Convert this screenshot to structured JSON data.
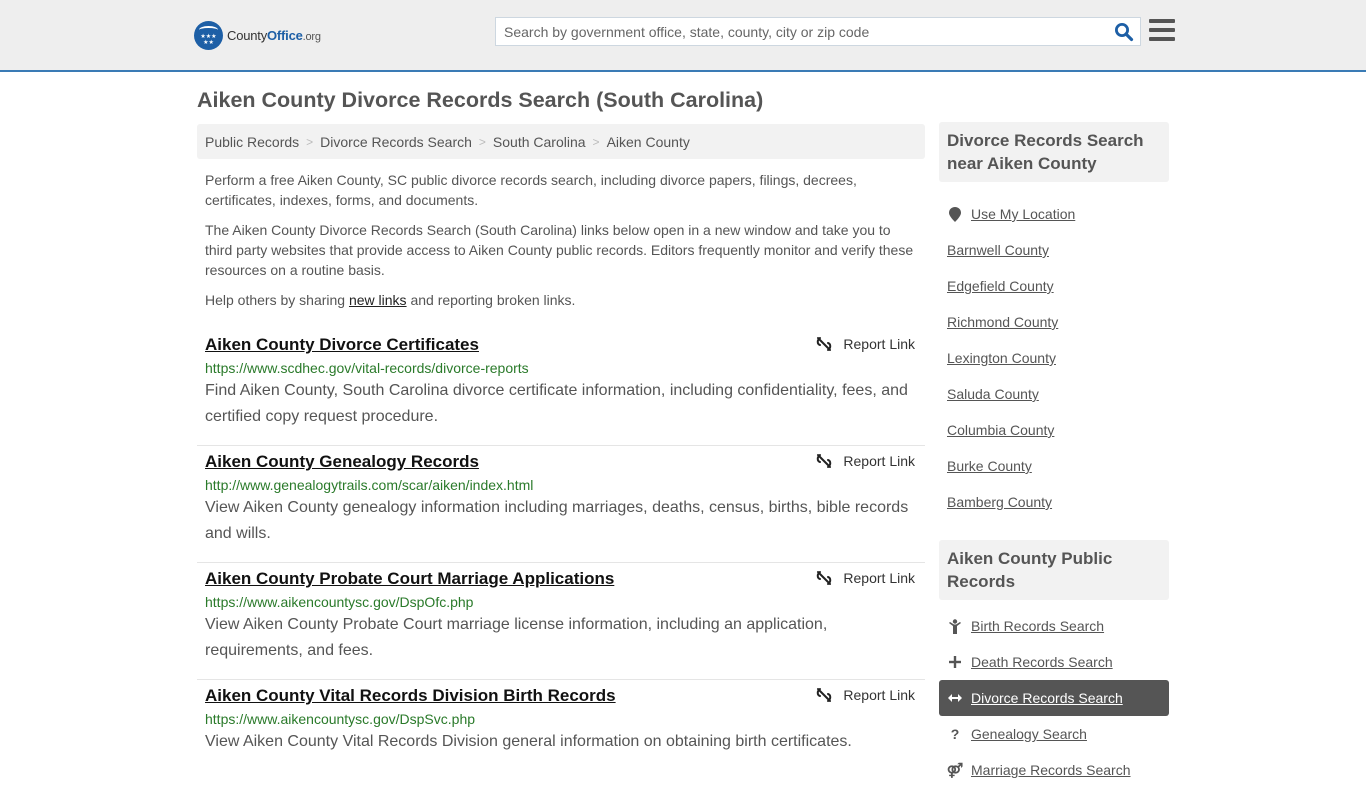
{
  "header": {
    "logo": {
      "brand_part1": "County",
      "brand_part2": "Office",
      "brand_part3": ".org"
    },
    "search": {
      "placeholder": "Search by government office, state, county, city or zip code",
      "value": ""
    },
    "colors": {
      "brand_blue": "#1d5fa6",
      "header_bg": "#eeeeee",
      "header_border": "#3a7bb5"
    }
  },
  "page": {
    "title": "Aiken County Divorce Records Search (South Carolina)"
  },
  "breadcrumb": [
    {
      "label": "Public Records"
    },
    {
      "label": "Divorce Records Search"
    },
    {
      "label": "South Carolina"
    },
    {
      "label": "Aiken County"
    }
  ],
  "breadcrumb_separator": ">",
  "intro": {
    "p1": "Perform a free Aiken County, SC public divorce records search, including divorce papers, filings, decrees, certificates, indexes, forms, and documents.",
    "p2": "The Aiken County Divorce Records Search (South Carolina) links below open in a new window and take you to third party websites that provide access to Aiken County public records. Editors frequently monitor and verify these resources on a routine basis.",
    "p3_before": "Help others by sharing ",
    "p3_link": "new links",
    "p3_after": " and reporting broken links."
  },
  "results": [
    {
      "title": "Aiken County Divorce Certificates",
      "url": "https://www.scdhec.gov/vital-records/divorce-reports",
      "description": "Find Aiken County, South Carolina divorce certificate information, including confidentiality, fees, and certified copy request procedure.",
      "report_label": "Report Link"
    },
    {
      "title": "Aiken County Genealogy Records",
      "url": "http://www.genealogytrails.com/scar/aiken/index.html",
      "description": "View Aiken County genealogy information including marriages, deaths, census, births, bible records and wills.",
      "report_label": "Report Link"
    },
    {
      "title": "Aiken County Probate Court Marriage Applications",
      "url": "https://www.aikencountysc.gov/DspOfc.php",
      "description": "View Aiken County Probate Court marriage license information, including an application, requirements, and fees.",
      "report_label": "Report Link"
    },
    {
      "title": "Aiken County Vital Records Division Birth Records",
      "url": "https://www.aikencountysc.gov/DspSvc.php",
      "description": "View Aiken County Vital Records Division general information on obtaining birth certificates.",
      "report_label": "Report Link"
    }
  ],
  "sidebar": {
    "nearby": {
      "heading": "Divorce Records Search near Aiken County",
      "use_location": {
        "label": "Use My Location",
        "icon": "map-marker-icon"
      },
      "counties": [
        "Barnwell County",
        "Edgefield County",
        "Richmond County",
        "Lexington County",
        "Saluda County",
        "Columbia County",
        "Burke County",
        "Bamberg County"
      ]
    },
    "public_records": {
      "heading": "Aiken County Public Records",
      "items": [
        {
          "label": "Birth Records Search",
          "icon": "baby-icon",
          "glyph": "ὫC",
          "active": false
        },
        {
          "label": "Death Records Search",
          "icon": "plus-icon",
          "glyph": "+",
          "active": false
        },
        {
          "label": "Divorce Records Search",
          "icon": "arrows-horizontal-icon",
          "glyph": "↔",
          "active": true
        },
        {
          "label": "Genealogy Search",
          "icon": "question-icon",
          "glyph": "?",
          "active": false
        },
        {
          "label": "Marriage Records Search",
          "icon": "marriage-icon",
          "glyph": "⚤",
          "active": false
        }
      ]
    }
  }
}
